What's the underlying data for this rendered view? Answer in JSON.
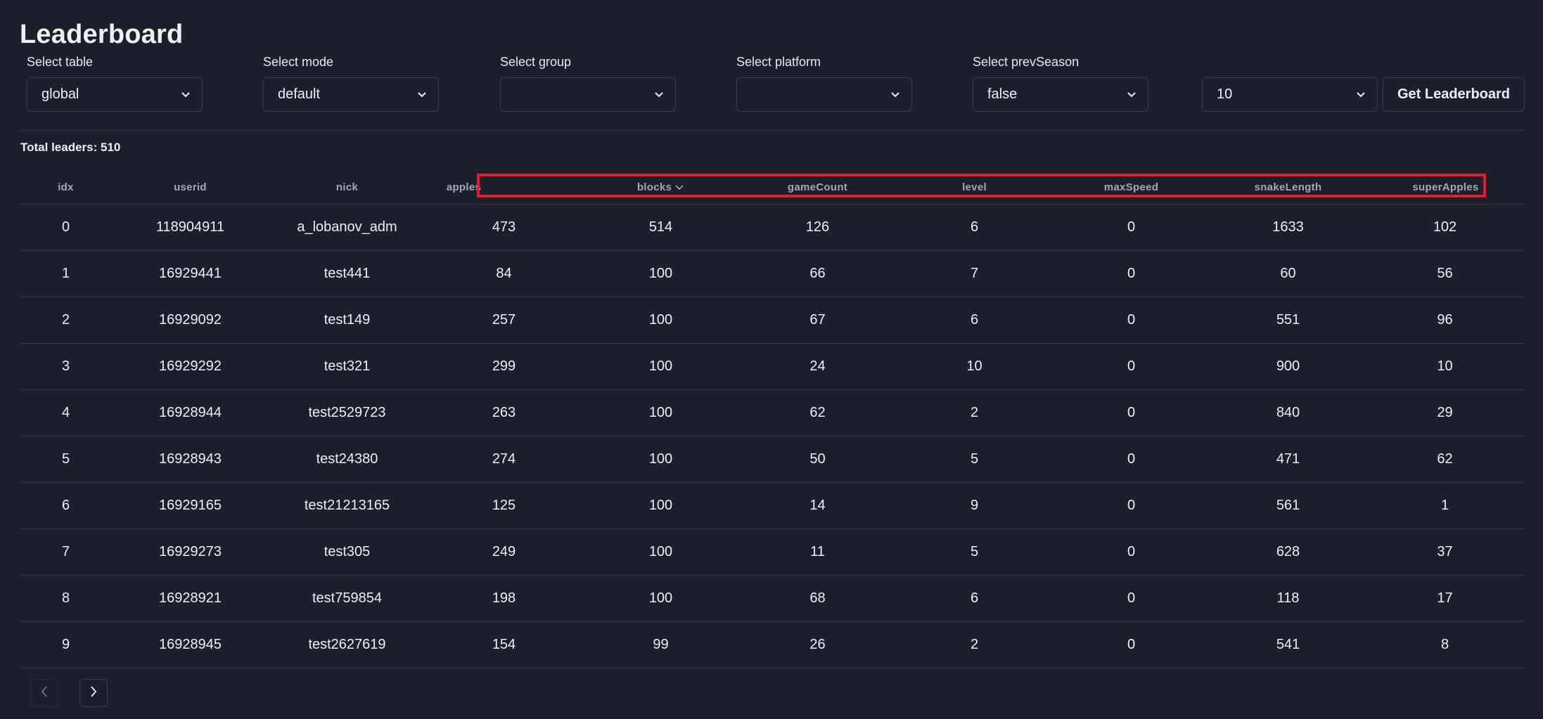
{
  "header": {
    "title": "Leaderboard"
  },
  "filters": [
    {
      "label": "Select table",
      "value": "global"
    },
    {
      "label": "Select mode",
      "value": "default"
    },
    {
      "label": "Select group",
      "value": ""
    },
    {
      "label": "Select platform",
      "value": ""
    },
    {
      "label": "Select prevSeason",
      "value": "false"
    }
  ],
  "limit_select": {
    "value": "10"
  },
  "actions": {
    "get_leaderboard": "Get Leaderboard"
  },
  "summary": {
    "total_leaders": "Total leaders: 510"
  },
  "table": {
    "columns": [
      "idx",
      "userid",
      "nick",
      "apples",
      "blocks",
      "gameCount",
      "level",
      "maxSpeed",
      "snakeLength",
      "superApples"
    ],
    "sorted_by": "blocks",
    "sort_direction": "desc",
    "rows": [
      [
        "0",
        "118904911",
        "a_lobanov_adm",
        "473",
        "514",
        "126",
        "6",
        "0",
        "1633",
        "102"
      ],
      [
        "1",
        "16929441",
        "test441",
        "84",
        "100",
        "66",
        "7",
        "0",
        "60",
        "56"
      ],
      [
        "2",
        "16929092",
        "test149",
        "257",
        "100",
        "67",
        "6",
        "0",
        "551",
        "96"
      ],
      [
        "3",
        "16929292",
        "test321",
        "299",
        "100",
        "24",
        "10",
        "0",
        "900",
        "10"
      ],
      [
        "4",
        "16928944",
        "test2529723",
        "263",
        "100",
        "62",
        "2",
        "0",
        "840",
        "29"
      ],
      [
        "5",
        "16928943",
        "test24380",
        "274",
        "100",
        "50",
        "5",
        "0",
        "471",
        "62"
      ],
      [
        "6",
        "16929165",
        "test21213165",
        "125",
        "100",
        "14",
        "9",
        "0",
        "561",
        "1"
      ],
      [
        "7",
        "16929273",
        "test305",
        "249",
        "100",
        "11",
        "5",
        "0",
        "628",
        "37"
      ],
      [
        "8",
        "16928921",
        "test759854",
        "198",
        "100",
        "68",
        "6",
        "0",
        "118",
        "17"
      ],
      [
        "9",
        "16928945",
        "test2627619",
        "154",
        "99",
        "26",
        "2",
        "0",
        "541",
        "8"
      ]
    ]
  },
  "pagination": {
    "prev_icon": "chevron-left-icon",
    "next_icon": "chevron-right-icon",
    "prev_disabled": true
  },
  "annotation": {
    "highlight_color": "#e21d2b"
  }
}
